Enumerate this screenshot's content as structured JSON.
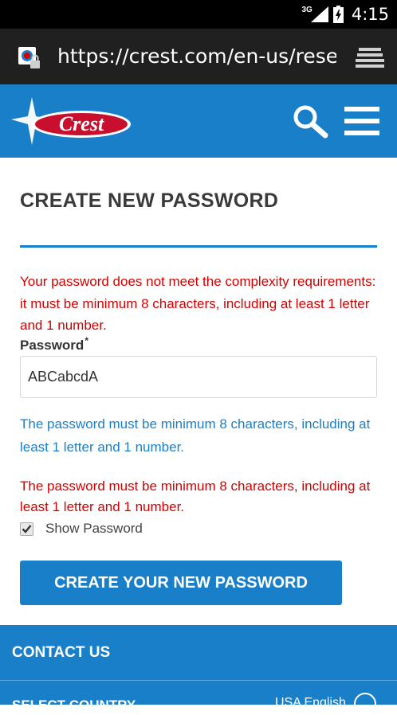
{
  "status_bar": {
    "network": "3G",
    "time": "4:15"
  },
  "browser": {
    "url": "https://crest.com/en-us/resetpassword"
  },
  "header": {
    "logo_text": "Crest"
  },
  "main": {
    "title": "CREATE NEW PASSWORD",
    "error_top": "Your password does not meet the complexity requirements: it must be minimum 8 characters, including at least 1 letter and 1 number.",
    "password_label": "Password",
    "required_mark": "*",
    "password_value": "ABCabcdA",
    "hint": "The password must be minimum 8 characters, including at least 1 letter and 1 number.",
    "error_bottom": "The password must be minimum 8 characters, including at least 1 letter and 1 number.",
    "show_password_label": "Show Password",
    "show_password_checked": true,
    "submit_label": "CREATE YOUR NEW PASSWORD"
  },
  "footer": {
    "contact_label": "CONTACT US",
    "country_label": "SELECT COUNTRY",
    "language": "USA English"
  },
  "colors": {
    "brand_blue": "#1a7fc9",
    "error_red": "#d40000"
  }
}
